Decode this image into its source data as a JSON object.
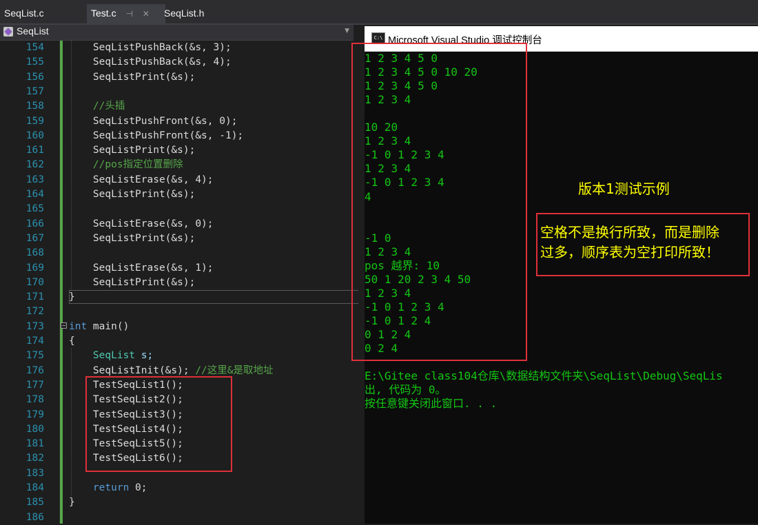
{
  "tabs": [
    {
      "label": "SeqList.c",
      "active": false
    },
    {
      "label": "Test.c",
      "active": true,
      "pin_icon": "pin-icon",
      "close_icon": "close-icon"
    },
    {
      "label": "SeqList.h",
      "active": false
    }
  ],
  "nav": {
    "scope": "SeqList",
    "dropdown_icon": "chevron-down-icon"
  },
  "editor": {
    "lines": [
      {
        "n": "154",
        "code": "    SeqListPushBack(&s, 3);"
      },
      {
        "n": "155",
        "code": "    SeqListPushBack(&s, 4);"
      },
      {
        "n": "156",
        "code": "    SeqListPrint(&s);"
      },
      {
        "n": "157",
        "code": ""
      },
      {
        "n": "158",
        "code": "    //头插"
      },
      {
        "n": "159",
        "code": "    SeqListPushFront(&s, 0);"
      },
      {
        "n": "160",
        "code": "    SeqListPushFront(&s, -1);"
      },
      {
        "n": "161",
        "code": "    SeqListPrint(&s);"
      },
      {
        "n": "162",
        "code": "    //pos指定位置删除"
      },
      {
        "n": "163",
        "code": "    SeqListErase(&s, 4);"
      },
      {
        "n": "164",
        "code": "    SeqListPrint(&s);"
      },
      {
        "n": "165",
        "code": ""
      },
      {
        "n": "166",
        "code": "    SeqListErase(&s, 0);"
      },
      {
        "n": "167",
        "code": "    SeqListPrint(&s);"
      },
      {
        "n": "168",
        "code": ""
      },
      {
        "n": "169",
        "code": "    SeqListErase(&s, 1);"
      },
      {
        "n": "170",
        "code": "    SeqListPrint(&s);"
      },
      {
        "n": "171",
        "code": "}"
      },
      {
        "n": "172",
        "code": ""
      },
      {
        "n": "173",
        "code": "int main()"
      },
      {
        "n": "174",
        "code": "{"
      },
      {
        "n": "175",
        "code": "    SeqList s;"
      },
      {
        "n": "176",
        "code": "    SeqListInit(&s); //这里&是取地址"
      },
      {
        "n": "177",
        "code": "    TestSeqList1();"
      },
      {
        "n": "178",
        "code": "    TestSeqList2();"
      },
      {
        "n": "179",
        "code": "    TestSeqList3();"
      },
      {
        "n": "180",
        "code": "    TestSeqList4();"
      },
      {
        "n": "181",
        "code": "    TestSeqList5();"
      },
      {
        "n": "182",
        "code": "    TestSeqList6();"
      },
      {
        "n": "183",
        "code": ""
      },
      {
        "n": "184",
        "code": "    return 0;"
      },
      {
        "n": "185",
        "code": "}"
      },
      {
        "n": "186",
        "code": ""
      }
    ]
  },
  "console": {
    "icon_text": "C:\\",
    "title": "Microsoft Visual Studio 调试控制台",
    "output_lines": [
      "1 2 3 4 5 0",
      "1 2 3 4 5 0 10 20",
      "1 2 3 4 5 0",
      "1 2 3 4",
      "",
      "10 20",
      "1 2 3 4",
      "-1 0 1 2 3 4",
      "1 2 3 4",
      "-1 0 1 2 3 4",
      "4",
      "",
      "",
      "-1 0",
      "1 2 3 4",
      "pos 越界: 10",
      "50 1 20 2 3 4 50",
      "1 2 3 4",
      "-1 0 1 2 3 4",
      "-1 0 1 2 4",
      "0 1 2 4",
      "0 2 4",
      "",
      "E:\\Gitee class104仓库\\数据结构文件夹\\SeqList\\Debug\\SeqLis",
      "出, 代码为 0。",
      "按任意键关闭此窗口. . ."
    ]
  },
  "annotation": {
    "title": "版本1测试示例",
    "note_lines": [
      "空格不是换行所致，而是删除",
      "过多，顺序表为空打印所致！"
    ]
  },
  "colors": {
    "console_text": "#13c713",
    "annotation_text": "#ffff00",
    "highlight_border": "#e0303a",
    "line_number": "#2b91af"
  }
}
